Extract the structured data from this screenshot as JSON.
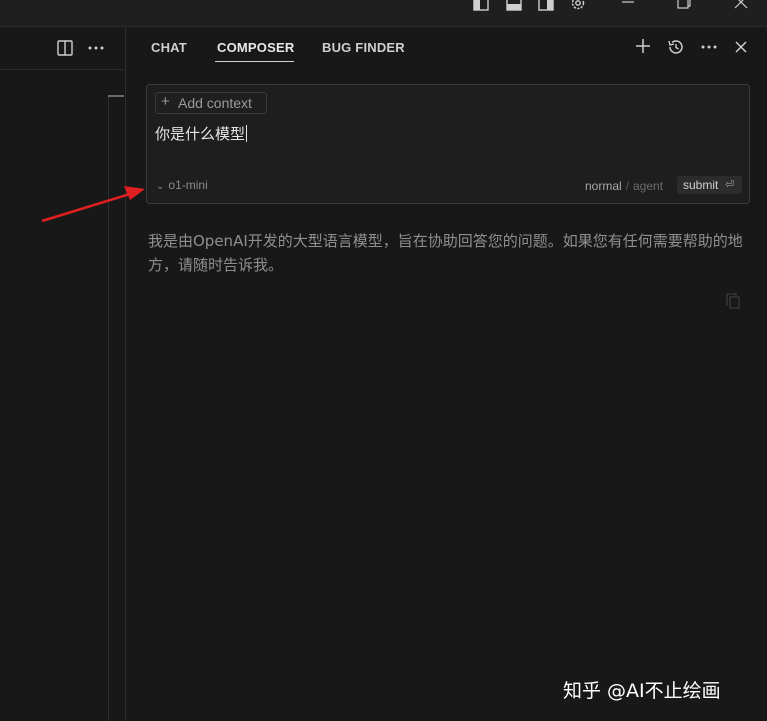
{
  "title_bar": {
    "icons": [
      "toggle-primary-sidebar-icon",
      "toggle-panel-icon",
      "toggle-secondary-sidebar-icon",
      "settings-gear-icon",
      "minimize-icon",
      "restore-icon",
      "close-icon"
    ]
  },
  "editor": {
    "actions": [
      "split-editor-icon",
      "more-actions-icon"
    ]
  },
  "panel": {
    "tabs": [
      {
        "label": "CHAT",
        "active": false
      },
      {
        "label": "COMPOSER",
        "active": true
      },
      {
        "label": "BUG FINDER",
        "active": false
      }
    ],
    "header_actions": [
      "new-composer-icon",
      "history-icon",
      "more-icon",
      "close-icon"
    ]
  },
  "composer": {
    "add_context_label": "Add context",
    "input_value": "你是什么模型",
    "model": "o1-mini",
    "mode_normal": "normal",
    "mode_separator": "/",
    "mode_agent": "agent",
    "submit_label": "submit",
    "submit_shortcut": "⏎"
  },
  "response": {
    "text": "我是由OpenAI开发的大型语言模型，旨在协助回答您的问题。如果您有任何需要帮助的地方，请随时告诉我。"
  },
  "watermark": {
    "text": "知乎 @AI不止绘画"
  },
  "colors": {
    "background": "#181818",
    "annotation_arrow": "#e02020"
  }
}
